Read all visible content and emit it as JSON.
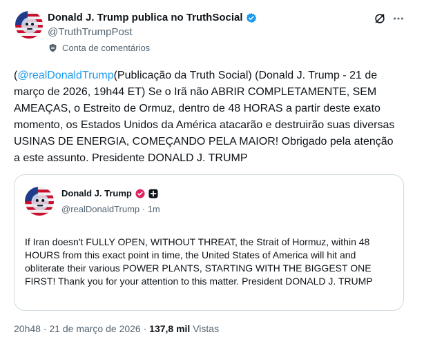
{
  "post": {
    "author_name": "Donald J. Trump publica no TruthSocial",
    "author_handle": "@TruthTrumpPost",
    "account_label": "Conta de comentários",
    "mention": "@realDonaldTrump",
    "body_after_mention": "(Publicação da Truth Social) (Donald J. Trump - 21 de março de 2026, 19h44 ET) Se o Irã não ABRIR COMPLETAMENTE, SEM AMEAÇAS, o Estreito de Ormuz, dentro de 48 HORAS a partir deste exato momento, os Estados Unidos da América atacarão e destruirão suas diversas USINAS DE ENERGIA, COMEÇANDO PELA MAIOR! Obrigado pela atenção a este assunto. Presidente DONALD J. TRUMP",
    "open_paren": "(",
    "time": "20h48",
    "separator": "·",
    "date": "21 de março de 2026",
    "views_count": "137,8 mil",
    "views_label": "Vistas"
  },
  "quote": {
    "author_name": "Donald J. Trump",
    "meta": "@realDonaldTrump · 1m",
    "body": "If Iran doesn't FULLY OPEN, WITHOUT THREAT, the Strait of Hormuz, within 48 HOURS from this exact point in time, the United States of America will hit and obliterate their various POWER PLANTS, STARTING WITH THE BIGGEST ONE FIRST! Thank you for your attention to this matter. President DONALD J. TRUMP"
  },
  "icons": {
    "verified": "verified-badge-icon",
    "shield": "shield-icon",
    "grok": "grok-icon",
    "more": "more-icon",
    "truth_verified": "truth-verified-icon",
    "truth_plus": "truth-plus-icon"
  },
  "colors": {
    "accent": "#1d9bf0",
    "text_primary": "#0f1419",
    "text_secondary": "#536471",
    "border": "#cfd9de",
    "truth_badge": "#e0245e"
  }
}
